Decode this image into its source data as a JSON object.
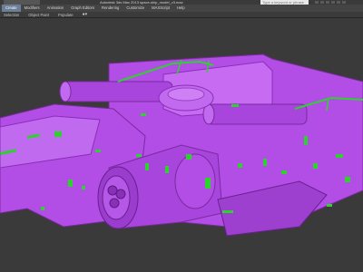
{
  "titlebar": {
    "title": "Autodesk 3ds Max 2013    space-ship_model_v3.max",
    "search_placeholder": "Type a keyword or phrase"
  },
  "menubar": {
    "items": [
      {
        "label": "Create",
        "active": true
      },
      {
        "label": "Modifiers",
        "active": false
      },
      {
        "label": "Animation",
        "active": false
      },
      {
        "label": "Graph Editors",
        "active": false
      },
      {
        "label": "Rendering",
        "active": false
      },
      {
        "label": "Customize",
        "active": false
      },
      {
        "label": "MAXScript",
        "active": false
      },
      {
        "label": "Help",
        "active": false
      }
    ]
  },
  "subbar": {
    "items": [
      "Selection",
      "Object Paint",
      "Populate"
    ],
    "options_icon": "options-dropdown-icon"
  },
  "viewport": {
    "model_name": "space-ship",
    "colors": {
      "background": "#3a3a3a",
      "hull": "#b24ee6",
      "hull_dark": "#8a2fb8",
      "hull_light": "#c76cf2",
      "accent": "#2ed12e"
    }
  }
}
